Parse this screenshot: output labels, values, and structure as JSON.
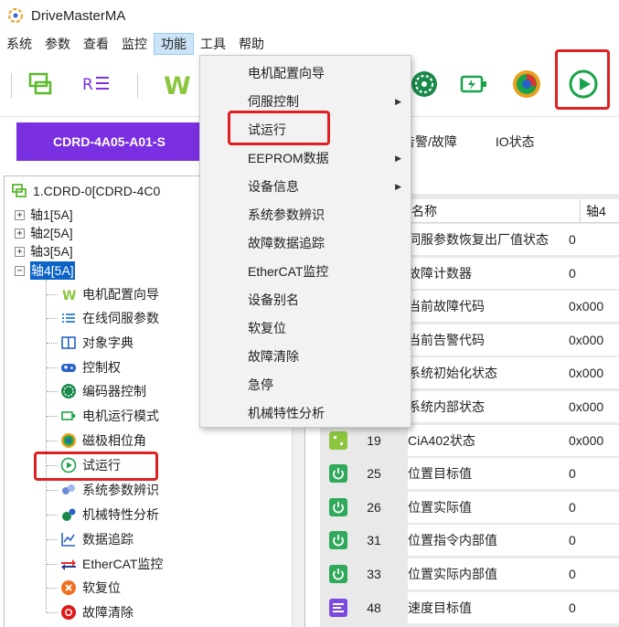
{
  "window": {
    "title": "DriveMasterMA"
  },
  "menubar": {
    "items": [
      {
        "label": "系统"
      },
      {
        "label": "参数"
      },
      {
        "label": "查看"
      },
      {
        "label": "监控"
      },
      {
        "label": "功能"
      },
      {
        "label": "工具"
      },
      {
        "label": "帮助"
      }
    ],
    "active_index": 4
  },
  "dropdown": {
    "items": [
      {
        "label": "电机配置向导",
        "submenu": false
      },
      {
        "label": "伺服控制",
        "submenu": true
      },
      {
        "label": "试运行",
        "submenu": false,
        "highlighted": true
      },
      {
        "label": "EEPROM数据",
        "submenu": true
      },
      {
        "label": "设备信息",
        "submenu": true
      },
      {
        "label": "系统参数辨识",
        "submenu": false
      },
      {
        "label": "故障数据追踪",
        "submenu": false
      },
      {
        "label": "EtherCAT监控",
        "submenu": false
      },
      {
        "label": "设备别名",
        "submenu": false
      },
      {
        "label": "软复位",
        "submenu": false
      },
      {
        "label": "故障清除",
        "submenu": false
      },
      {
        "label": "急停",
        "submenu": false
      },
      {
        "label": "机械特性分析",
        "submenu": false
      }
    ]
  },
  "device_tab": {
    "label": "CDRD-4A05-A01-S"
  },
  "tabs": [
    {
      "label": "告警/故障"
    },
    {
      "label": "IO状态"
    }
  ],
  "tree": {
    "root": {
      "label": "1.CDRD-0[CDRD-4C0"
    },
    "axes": [
      {
        "label": "轴1[5A]",
        "expander": "+"
      },
      {
        "label": "轴2[5A]",
        "expander": "+"
      },
      {
        "label": "轴3[5A]",
        "expander": "+"
      },
      {
        "label": "轴4[5A]",
        "expander": "−"
      }
    ],
    "children": [
      {
        "label": "电机配置向导",
        "icon": "motor-wizard-icon"
      },
      {
        "label": "在线伺服参数",
        "icon": "parameter-list-icon"
      },
      {
        "label": "对象字典",
        "icon": "dictionary-icon"
      },
      {
        "label": "控制权",
        "icon": "gamepad-icon"
      },
      {
        "label": "编码器控制",
        "icon": "encoder-icon"
      },
      {
        "label": "电机运行模式",
        "icon": "run-mode-icon"
      },
      {
        "label": "磁极相位角",
        "icon": "phase-angle-icon"
      },
      {
        "label": "试运行",
        "icon": "play-circle-icon",
        "highlighted": true
      },
      {
        "label": "系统参数辨识",
        "icon": "identification-icon"
      },
      {
        "label": "机械特性分析",
        "icon": "analysis-icon"
      },
      {
        "label": "数据追踪",
        "icon": "trace-chart-icon"
      },
      {
        "label": "EtherCAT监控",
        "icon": "ethercat-icon"
      },
      {
        "label": "软复位",
        "icon": "soft-reset-icon"
      },
      {
        "label": "故障清除",
        "icon": "fault-clear-icon"
      }
    ]
  },
  "grid": {
    "columns": {
      "name": "名称",
      "axis": "轴4"
    },
    "rows": [
      {
        "index": "",
        "name": "伺服参数恢复出厂值状态",
        "value": "0"
      },
      {
        "index": "",
        "name": "故障计数器",
        "value": "0"
      },
      {
        "index": "",
        "name": "当前故障代码",
        "value": "0x000"
      },
      {
        "index": "",
        "name": "当前告警代码",
        "value": "0x000"
      },
      {
        "index": "",
        "name": "系统初始化状态",
        "value": "0x000"
      },
      {
        "index": "",
        "name": "系统内部状态",
        "value": "0x000"
      },
      {
        "index": "19",
        "name": "CiA402状态",
        "value": "0x000"
      },
      {
        "index": "25",
        "name": "位置目标值",
        "value": "0"
      },
      {
        "index": "26",
        "name": "位置实际值",
        "value": "0"
      },
      {
        "index": "31",
        "name": "位置指令内部值",
        "value": "0"
      },
      {
        "index": "33",
        "name": "位置实际内部值",
        "value": "0"
      },
      {
        "index": "48",
        "name": "速度目标值",
        "value": "0"
      }
    ]
  },
  "colors": {
    "accent_purple": "#7a2fe0",
    "highlight_red": "#e02020",
    "selection_blue": "#0c64c8",
    "menu_active": "#cce4f7",
    "play_green": "#1aa34a"
  }
}
